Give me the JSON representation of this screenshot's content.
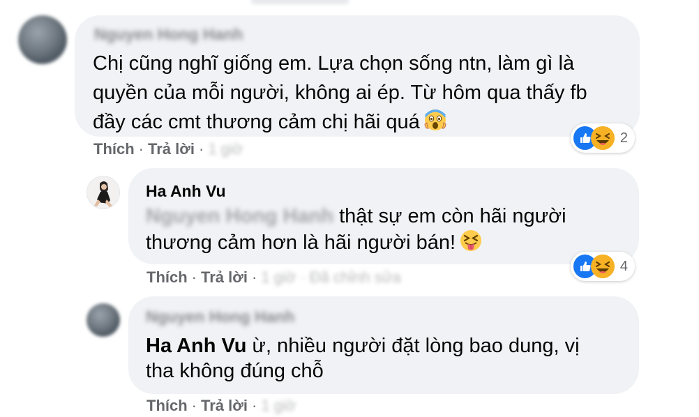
{
  "comments": [
    {
      "author": "Nguyen Hong Hanh",
      "lines": [
        "Chị cũng nghĩ giống em. Lựa chọn sống ntn, làm gì là",
        "quyền của mỗi người, không ai ép. Từ hôm qua thấy fb",
        "đầy các cmt thương cảm chị hãi quá"
      ],
      "like_label": "Thích",
      "reply_label": "Trả lời",
      "time": "1 giờ",
      "reaction_count": "2"
    },
    {
      "author": "Ha Anh Vu",
      "tag": "Nguyen Hong Hanh",
      "line1": "thật sự em còn hãi người",
      "line2": "thương cảm hơn là hãi người bán!",
      "like_label": "Thích",
      "reply_label": "Trả lời",
      "time": "1 giờ · Đã chỉnh sửa",
      "reaction_count": "4"
    },
    {
      "author": "Nguyen Hong Hanh",
      "mention": "Ha Anh Vu",
      "line1": "ừ, nhiều người đặt lòng bao dung, vị",
      "line2": "tha không đúng chỗ",
      "like_label": "Thích",
      "reply_label": "Trả lời",
      "time": "1 giờ"
    }
  ],
  "colors": {
    "bubble": "#f0f2f5",
    "meta": "#65676b",
    "like": "#1877f2",
    "haha": "#f7b125"
  },
  "icons": {
    "like": "like-reaction-icon",
    "haha": "haha-reaction-icon",
    "scream": "face-screaming-in-fear-emoji",
    "tongue": "squinting-face-with-tongue-emoji"
  }
}
